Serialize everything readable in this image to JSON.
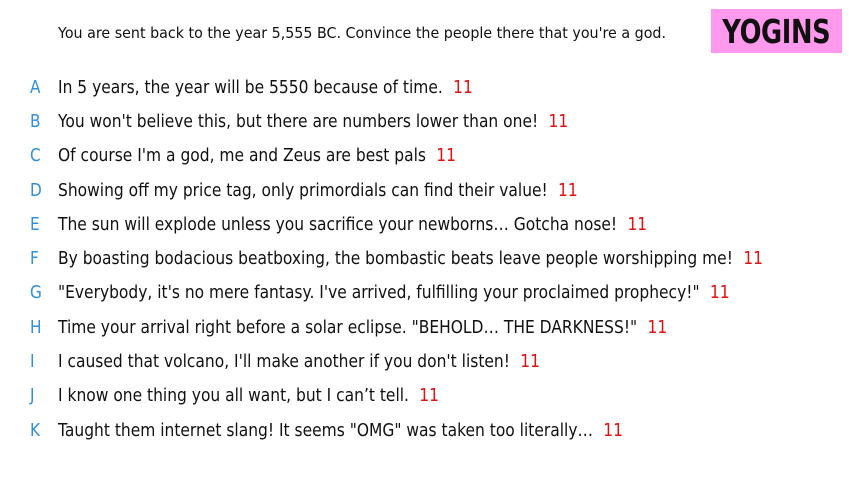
{
  "prompt": "You are sent back to the year 5,555 BC. Convince the people there that you're a god.",
  "team": {
    "name": "YOGINS",
    "badge_color": "#ff99ee"
  },
  "colors": {
    "letter": "#2f8fd8",
    "score": "#e01010",
    "text": "#111111"
  },
  "answers": [
    {
      "letter": "A",
      "text": "In 5 years, the year will be 5550 because of time.",
      "score": "11"
    },
    {
      "letter": "B",
      "text": "You won't believe this, but there are numbers lower than one!",
      "score": "11"
    },
    {
      "letter": "C",
      "text": "Of course I'm a god, me and Zeus are best pals",
      "score": "11"
    },
    {
      "letter": "D",
      "text": "Showing off my price tag, only primordials can find their value!",
      "score": "11"
    },
    {
      "letter": "E",
      "text": "The sun will explode unless you sacrifice your newborns… Gotcha nose!",
      "score": "11"
    },
    {
      "letter": "F",
      "text": "By boasting bodacious beatboxing, the bombastic beats leave people worshipping me!",
      "score": "11"
    },
    {
      "letter": "G",
      "text": "\"Everybody, it's no mere fantasy. I've arrived, fulfilling your proclaimed prophecy!\"",
      "score": "11"
    },
    {
      "letter": "H",
      "text": "Time your arrival right before a solar eclipse. \"BEHOLD… THE DARKNESS!\"",
      "score": "11"
    },
    {
      "letter": "I",
      "text": "I caused that volcano, I'll make another if you don't listen!",
      "score": "11"
    },
    {
      "letter": "J",
      "text": "I know one thing you all want, but I can’t tell.",
      "score": "11"
    },
    {
      "letter": "K",
      "text": "Taught them internet slang! It seems \"OMG\" was taken too literally…",
      "score": "11"
    }
  ]
}
